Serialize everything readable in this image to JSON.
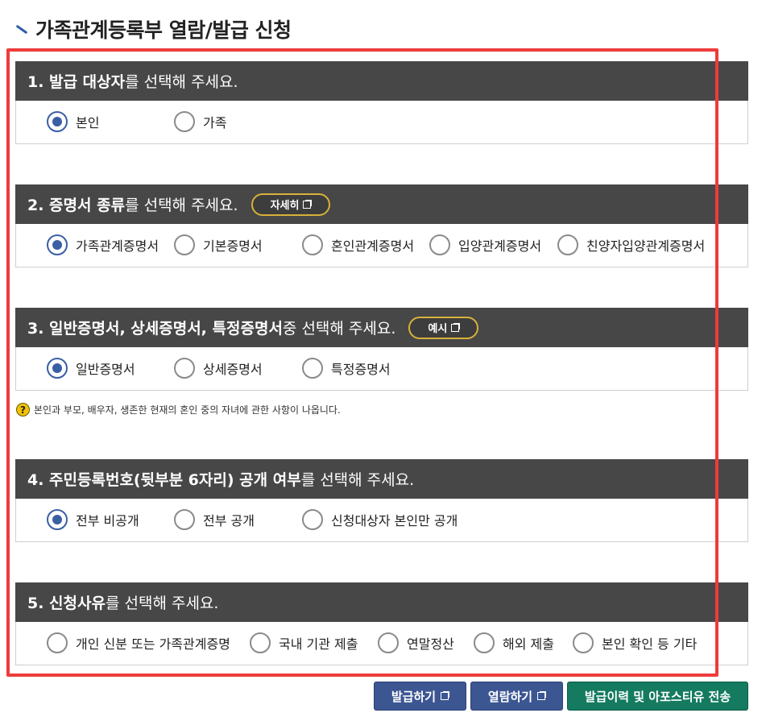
{
  "page": {
    "title": "가족관계등록부 열람/발급 신청"
  },
  "sections": [
    {
      "heading_strong": "1. 발급 대상자",
      "heading_rest": "를 선택해 주세요.",
      "options": [
        {
          "label": "본인",
          "checked": true
        },
        {
          "label": "가족",
          "checked": false
        }
      ]
    },
    {
      "heading_strong": "2. 증명서 종류",
      "heading_rest": "를 선택해 주세요.",
      "button": "자세히",
      "options": [
        {
          "label": "가족관계증명서",
          "checked": true
        },
        {
          "label": "기본증명서",
          "checked": false
        },
        {
          "label": "혼인관계증명서",
          "checked": false
        },
        {
          "label": "입양관계증명서",
          "checked": false
        },
        {
          "label": "친양자입양관계증명서",
          "checked": false
        }
      ]
    },
    {
      "heading_strong": "3. 일반증명서, 상세증명서, 특정증명서",
      "heading_rest": " 중 선택해 주세요.",
      "button": "예시",
      "options": [
        {
          "label": "일반증명서",
          "checked": true
        },
        {
          "label": "상세증명서",
          "checked": false
        },
        {
          "label": "특정증명서",
          "checked": false
        }
      ],
      "help": "본인과 부모, 배우자, 생존한 현재의 혼인 중의 자녀에 관한 사항이 나옵니다."
    },
    {
      "heading_strong": "4. 주민등록번호(뒷부분 6자리) 공개 여부",
      "heading_rest": "를 선택해 주세요.",
      "options": [
        {
          "label": "전부 비공개",
          "checked": true
        },
        {
          "label": "전부 공개",
          "checked": false
        },
        {
          "label": "신청대상자 본인만 공개",
          "checked": false
        }
      ]
    },
    {
      "heading_strong": "5. 신청사유",
      "heading_rest": "를 선택해 주세요.",
      "options": [
        {
          "label": "개인 신분 또는 가족관계증명",
          "checked": false
        },
        {
          "label": "국내 기관 제출",
          "checked": false
        },
        {
          "label": "연말정산",
          "checked": false
        },
        {
          "label": "해외 제출",
          "checked": false
        },
        {
          "label": "본인 확인 등 기타",
          "checked": false
        }
      ]
    }
  ],
  "actions": {
    "issue": "발급하기",
    "view": "열람하기",
    "history": "발급이력 및 아포스티유 전송"
  },
  "colors": {
    "header_bg": "#474747",
    "radio_checked": "#3a5fa5",
    "highlight_frame": "#ee3b3b",
    "btn_blue": "#3c5692",
    "btn_green": "#147a60",
    "pill_border": "#d8b13a"
  }
}
